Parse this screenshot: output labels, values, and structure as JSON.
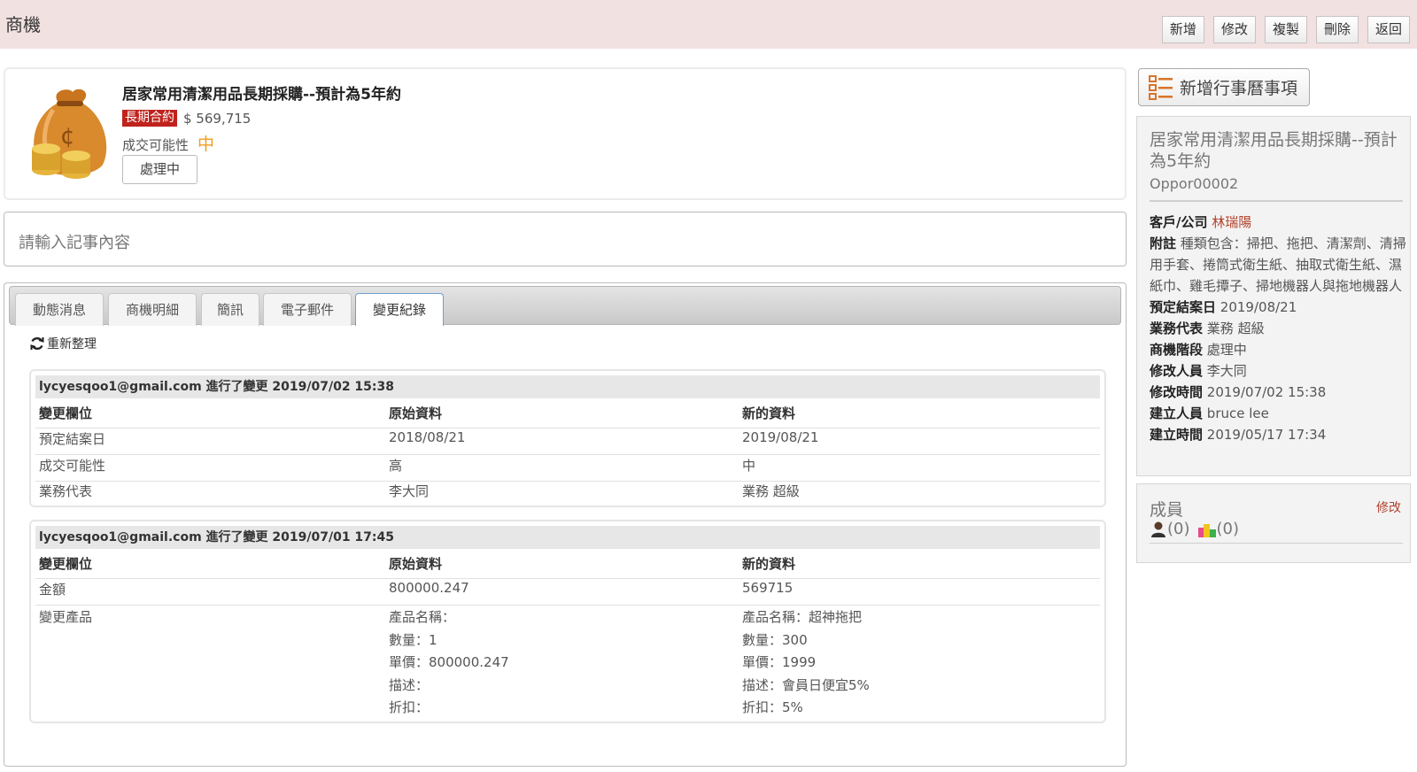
{
  "header": {
    "title": "商機",
    "buttons": [
      "新增",
      "修改",
      "複製",
      "刪除",
      "返回"
    ]
  },
  "summary": {
    "title": "居家常用清潔用品長期採購--預計為5年約",
    "contract_type": "長期合約",
    "amount": "$ 569,715",
    "prob_label": "成交可能性",
    "prob_value": "中",
    "status": "處理中"
  },
  "note": {
    "placeholder": "請輸入記事內容"
  },
  "tabs": [
    "動態消息",
    "商機明細",
    "簡訊",
    "電子郵件",
    "變更紀錄"
  ],
  "refresh_label": "重新整理",
  "changes": [
    {
      "header": "lycyesqoo1@gmail.com 進行了變更 2019/07/02 15:38",
      "cols": [
        "變更欄位",
        "原始資料",
        "新的資料"
      ],
      "rows": [
        [
          "預定結案日",
          "2018/08/21",
          "2019/08/21"
        ],
        [
          "成交可能性",
          "高",
          "中"
        ],
        [
          "業務代表",
          "李大同",
          "業務 超級"
        ]
      ]
    },
    {
      "header": "lycyesqoo1@gmail.com 進行了變更 2019/07/01 17:45",
      "cols": [
        "變更欄位",
        "原始資料",
        "新的資料"
      ],
      "rows": [
        [
          "金額",
          "800000.247",
          "569715"
        ]
      ],
      "product": {
        "field": "變更產品",
        "old": [
          "產品名稱：",
          "數量：1",
          "單價：800000.247",
          "描述：",
          "折扣："
        ],
        "new": [
          "產品名稱：超神拖把",
          "數量：300",
          "單價：1999",
          "描述：會員日便宜5%",
          "折扣：5%"
        ]
      }
    }
  ],
  "sidebar": {
    "add_calendar": "新增行事曆事項",
    "title": "居家常用清潔用品長期採購--預計為5年約",
    "id": "Oppor00002",
    "customer_label": "客戶/公司",
    "customer": "林瑞陽",
    "note_label": "附註",
    "note": "種類包含：掃把、拖把、清潔劑、清掃用手套、捲筒式衛生紙、抽取式衛生紙、濕紙巾、雞毛撢子、掃地機器人與拖地機器人",
    "fields": [
      [
        "預定結案日",
        "2019/08/21"
      ],
      [
        "業務代表",
        "業務 超級"
      ],
      [
        "商機階段",
        "處理中"
      ],
      [
        "修改人員",
        "李大同"
      ],
      [
        "修改時間",
        "2019/07/02 15:38"
      ],
      [
        "建立人員",
        "bruce lee"
      ],
      [
        "建立時間",
        "2019/05/17 17:34"
      ]
    ],
    "members_title": "成員",
    "members_edit": "修改",
    "members_users": "(0)",
    "members_groups": "(0)"
  },
  "colors": {
    "topbar": "#f2e1e1",
    "badge": "#c0221c",
    "prob": "#f29c1f",
    "link": "#b2402a"
  }
}
